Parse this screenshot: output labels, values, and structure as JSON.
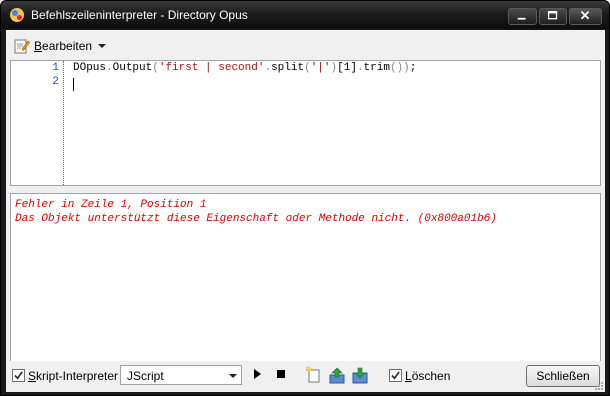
{
  "window": {
    "title": "Befehlszeileninterpreter - Directory Opus"
  },
  "toolbar": {
    "edit_label": "Bearbeiten"
  },
  "editor": {
    "lines": [
      {
        "number": "1",
        "code": "DOpus.Output('first | second'.split('|')[1].trim());"
      },
      {
        "number": "2",
        "code": ""
      }
    ],
    "tokens": {
      "obj": "DOpus",
      "dot1": ".",
      "method": "Output",
      "lp": "(",
      "str1": "'first | second'",
      "dot2": ".",
      "split": "split",
      "lp2": "(",
      "str2": "'|'",
      "rp2": ")",
      "idx": "[1]",
      "dot3": ".",
      "trim": "trim",
      "call": "()",
      "rp": ")",
      "semi": ";"
    }
  },
  "output": {
    "lines": [
      "Fehler in Zeile 1, Position 1",
      "Das Objekt unterstützt diese Eigenschaft oder Methode nicht. (0x800a01b6)"
    ],
    "color": "#e00000"
  },
  "status": {
    "script_label": "Skript-Interpreter",
    "script_checked": true,
    "language": "JScript",
    "clear_label": "Löschen",
    "clear_checked": true,
    "close_label": "Schließen"
  }
}
